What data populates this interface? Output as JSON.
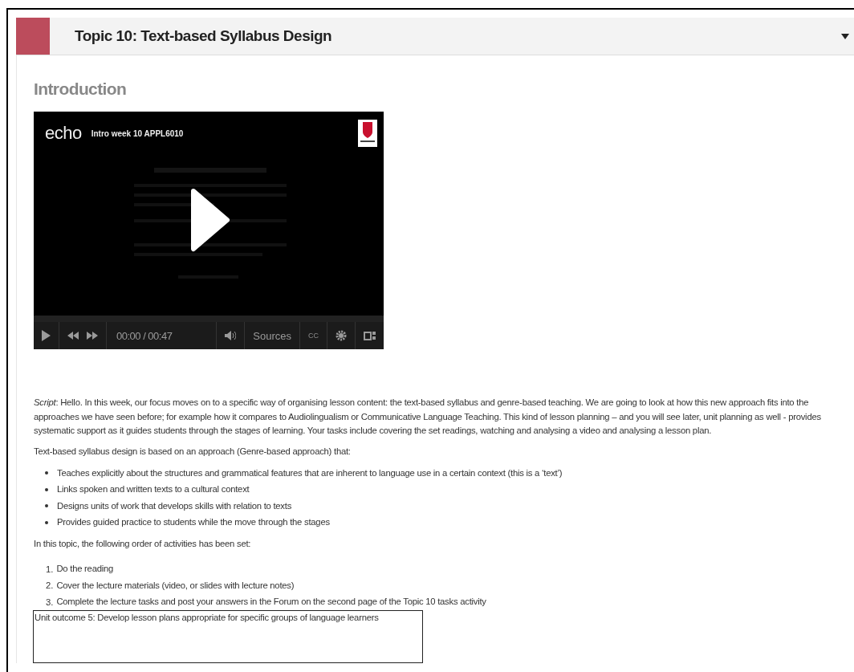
{
  "section": {
    "title": "Topic 10: Text-based Syllabus Design",
    "expanded": true
  },
  "heading": "Introduction",
  "video": {
    "brand": "echo",
    "title": "Intro week 10 APPL6010",
    "time": "00:00 / 00:47",
    "sources": "Sources",
    "captions": "CC",
    "playing": false
  },
  "script": "*Script*: Hello. In this week, our focus moves on to a specific way of organising lesson content: the text-based syllabus and genre-based teaching. We are going to look at how this new approach fits into the approaches we have seen before; for example how it compares to Audiolingualism or Communicative Language Teaching. This kind of lesson planning – and you will see later, unit planning as well - provides systematic support as it guides students through the stages of learning. Your tasks include covering the set readings, watching and analysing a video and analysing a lesson plan.",
  "approach_intro": "Text-based syllabus design is based on an approach (Genre-based approach) that:",
  "approach_points": [
    "Teaches explicitly about the structures and grammatical features that are inherent to language use in a certain context (this is a ‘text’)",
    "Links spoken and written texts to a cultural context",
    "Designs units of work that develops skills with relation to texts",
    "Provides guided practice to students while the move through the stages"
  ],
  "order_intro": "In this topic, the following order of activities has been set:",
  "order_steps": [
    {
      "number": "1.",
      "text": "Do the reading"
    },
    {
      "number": "2.",
      "text": "Cover the lecture materials (video, or slides with lecture notes)"
    },
    {
      "number": "3.",
      "text": "Complete the lecture tasks and post your answers in the Forum on the second page of the Topic 10 tasks activity"
    }
  ],
  "outcome": "Unit outcome 5: Develop lesson plans appropriate for specific groups of language learners"
}
